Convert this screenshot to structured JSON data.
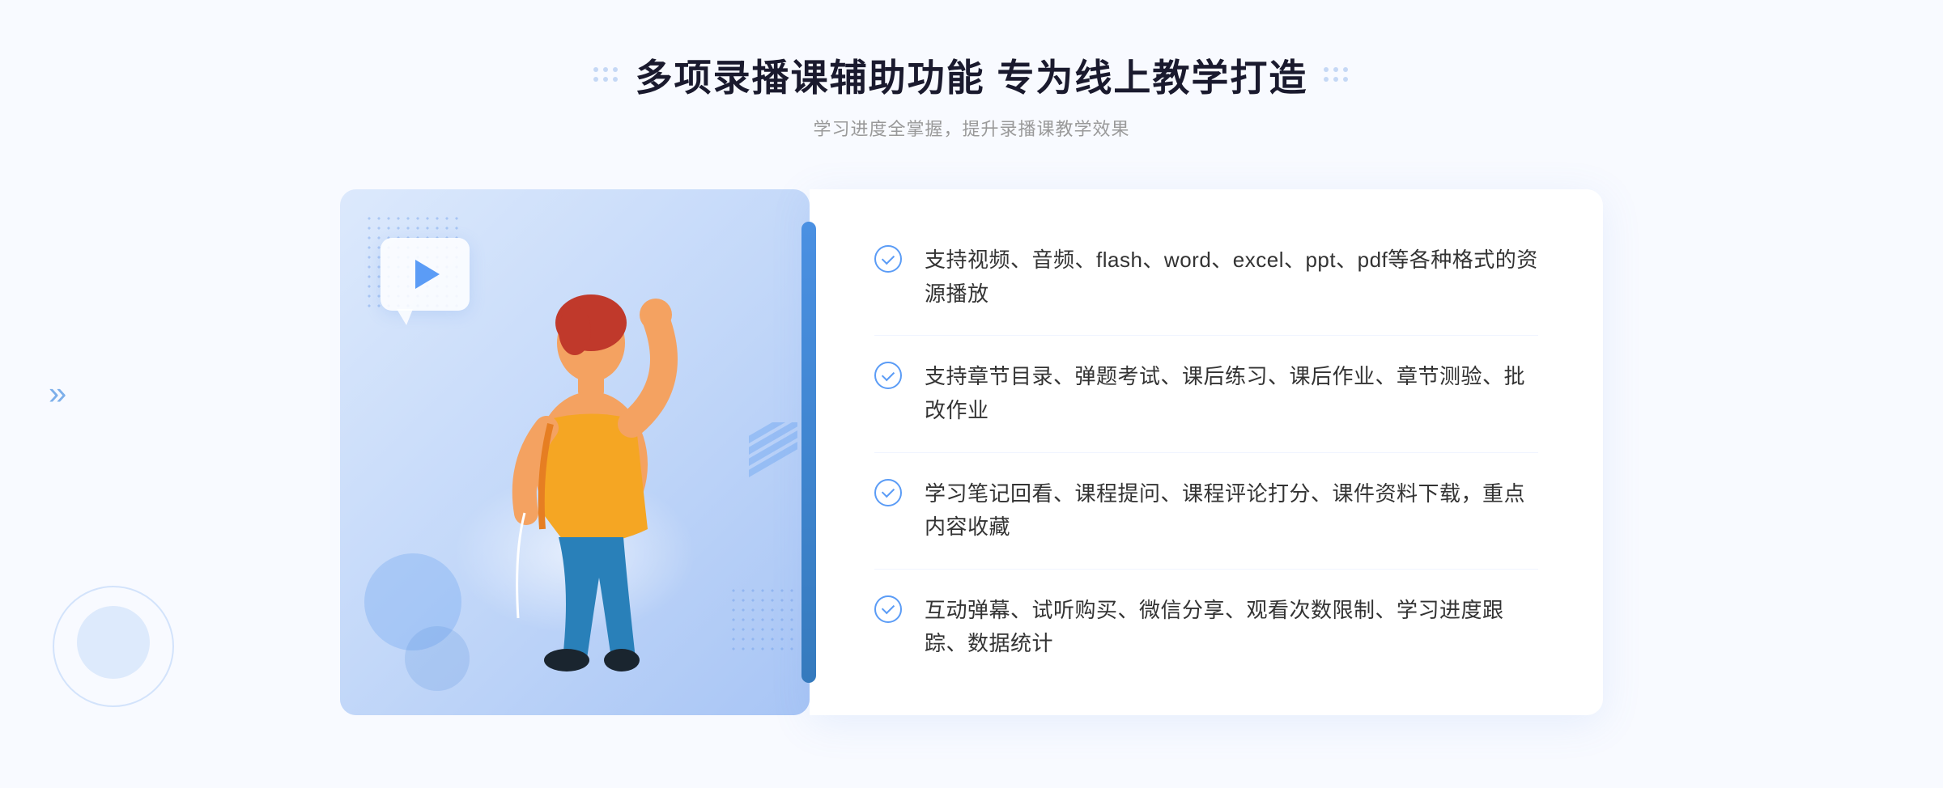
{
  "header": {
    "title": "多项录播课辅助功能 专为线上教学打造",
    "subtitle": "学习进度全掌握，提升录播课教学效果"
  },
  "features": [
    {
      "id": 1,
      "text": "支持视频、音频、flash、word、excel、ppt、pdf等各种格式的资源播放"
    },
    {
      "id": 2,
      "text": "支持章节目录、弹题考试、课后练习、课后作业、章节测验、批改作业"
    },
    {
      "id": 3,
      "text": "学习笔记回看、课程提问、课程评论打分、课件资料下载，重点内容收藏"
    },
    {
      "id": 4,
      "text": "互动弹幕、试听购买、微信分享、观看次数限制、学习进度跟踪、数据统计"
    }
  ],
  "decorators": {
    "left_arrow": "»",
    "dot_color": "#c5d8f5",
    "accent_color": "#4a90e2",
    "check_color": "#5b9cf6"
  }
}
